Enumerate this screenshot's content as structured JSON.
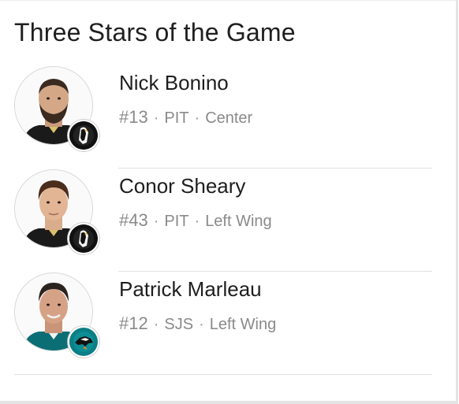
{
  "widget": {
    "title": "Three Stars of the Game"
  },
  "players": [
    {
      "name": "Nick Bonino",
      "number": "#13",
      "team": "PIT",
      "position": "Center",
      "team_color": "#111111",
      "team_icon": "penguin-logo-icon"
    },
    {
      "name": "Conor Sheary",
      "number": "#43",
      "team": "PIT",
      "position": "Left Wing",
      "team_color": "#111111",
      "team_icon": "penguin-logo-icon"
    },
    {
      "name": "Patrick Marleau",
      "number": "#12",
      "team": "SJS",
      "position": "Left Wing",
      "team_color": "#0b7f86",
      "team_icon": "shark-logo-icon"
    }
  ],
  "separator": "·"
}
